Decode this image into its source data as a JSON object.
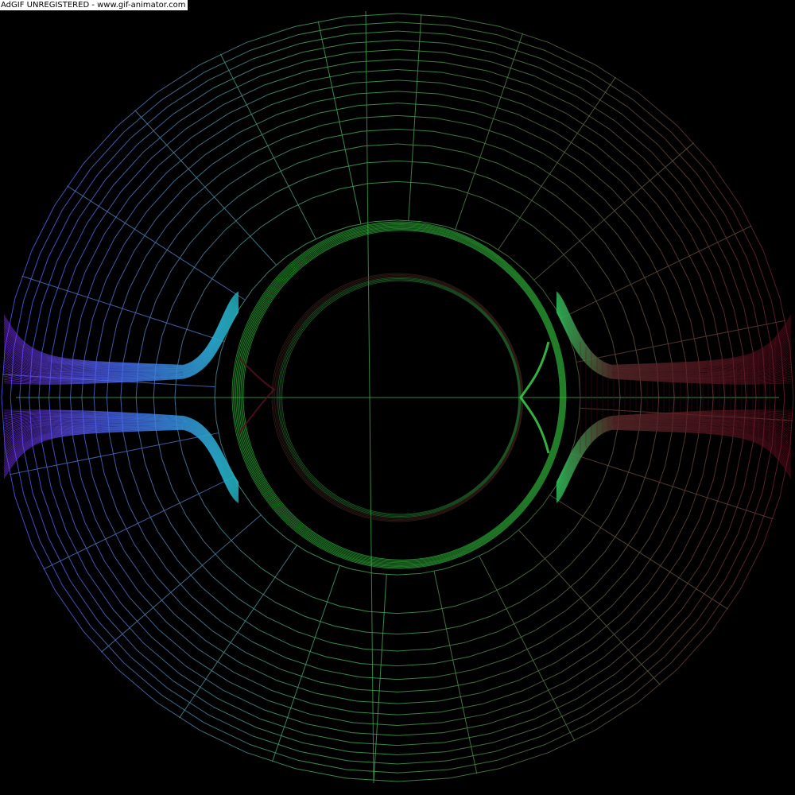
{
  "watermark": {
    "text": "AdGIF UNREGISTERED - www.gif-animator.com"
  },
  "colors": {
    "background": "#000000",
    "grid_left": "#5a5aff",
    "grid_center": "#3fb04a",
    "grid_right": "#7a2035",
    "funnel_left": "#6a3cf0",
    "funnel_mid": "#2ea0c8",
    "ring": "#35c640",
    "funnel_right": "#701525"
  }
}
